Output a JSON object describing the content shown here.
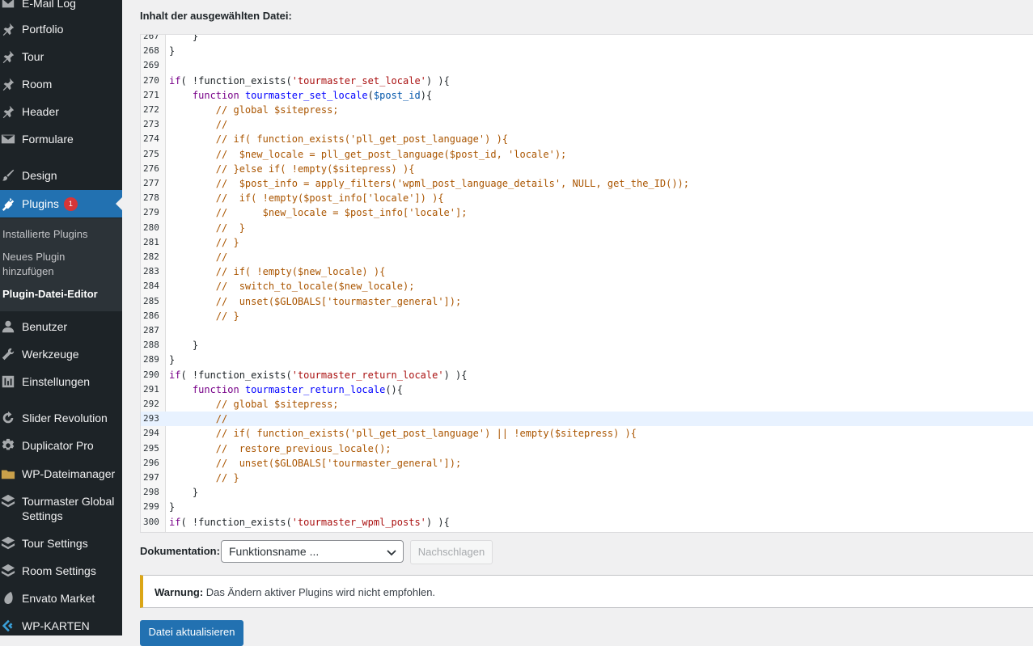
{
  "sidebar": {
    "items": [
      {
        "label": "E-Mail Log",
        "icon": "mail-log-icon"
      },
      {
        "label": "Portfolio",
        "icon": "pin-icon"
      },
      {
        "label": "Tour",
        "icon": "pin-icon"
      },
      {
        "label": "Room",
        "icon": "pin-icon"
      },
      {
        "label": "Header",
        "icon": "pin-icon"
      },
      {
        "label": "Formulare",
        "icon": "mail-icon"
      },
      {
        "label": "Design",
        "icon": "brush-icon"
      },
      {
        "label": "Plugins",
        "icon": "plugin-icon",
        "badge": "1"
      },
      {
        "label": "Benutzer",
        "icon": "user-icon"
      },
      {
        "label": "Werkzeuge",
        "icon": "wrench-icon"
      },
      {
        "label": "Einstellungen",
        "icon": "settings-icon"
      },
      {
        "label": "Slider Revolution",
        "icon": "refresh-icon"
      },
      {
        "label": "Duplicator Pro",
        "icon": "gear-icon"
      },
      {
        "label": "WP-Dateimanager",
        "icon": "folder-icon"
      },
      {
        "label": "Tourmaster Global Settings",
        "icon": "layers-icon"
      },
      {
        "label": "Tour Settings",
        "icon": "layers-icon"
      },
      {
        "label": "Room Settings",
        "icon": "layers-icon"
      },
      {
        "label": "Envato Market",
        "icon": "envato-icon"
      },
      {
        "label": "WP-KARTEN",
        "icon": "map-icon"
      }
    ],
    "submenu": [
      {
        "label": "Installierte Plugins"
      },
      {
        "label": "Neues Plugin hinzufügen"
      },
      {
        "label": "Plugin-Datei-Editor"
      }
    ]
  },
  "main": {
    "file_heading": "Inhalt der ausgewählten Datei:",
    "code_lines": [
      {
        "n": "267",
        "code": "    }"
      },
      {
        "n": "268",
        "code": "}"
      },
      {
        "n": "269",
        "code": ""
      },
      {
        "n": "270",
        "code": "if( !function_exists('tourmaster_set_locale') ){"
      },
      {
        "n": "271",
        "code": "    function tourmaster_set_locale($post_id){"
      },
      {
        "n": "272",
        "code": "        // global $sitepress;"
      },
      {
        "n": "273",
        "code": "        //"
      },
      {
        "n": "274",
        "code": "        // if( function_exists('pll_get_post_language') ){"
      },
      {
        "n": "275",
        "code": "        //  $new_locale = pll_get_post_language($post_id, 'locale');"
      },
      {
        "n": "276",
        "code": "        // }else if( !empty($sitepress) ){"
      },
      {
        "n": "277",
        "code": "        //  $post_info = apply_filters('wpml_post_language_details', NULL, get_the_ID());"
      },
      {
        "n": "278",
        "code": "        //  if( !empty($post_info['locale']) ){"
      },
      {
        "n": "279",
        "code": "        //      $new_locale = $post_info['locale'];"
      },
      {
        "n": "280",
        "code": "        //  }"
      },
      {
        "n": "281",
        "code": "        // }"
      },
      {
        "n": "282",
        "code": "        //"
      },
      {
        "n": "283",
        "code": "        // if( !empty($new_locale) ){"
      },
      {
        "n": "284",
        "code": "        //  switch_to_locale($new_locale);"
      },
      {
        "n": "285",
        "code": "        //  unset($GLOBALS['tourmaster_general']);"
      },
      {
        "n": "286",
        "code": "        // }"
      },
      {
        "n": "287",
        "code": ""
      },
      {
        "n": "288",
        "code": "    }"
      },
      {
        "n": "289",
        "code": "}"
      },
      {
        "n": "290",
        "code": "if( !function_exists('tourmaster_return_locale') ){"
      },
      {
        "n": "291",
        "code": "    function tourmaster_return_locale(){"
      },
      {
        "n": "292",
        "code": "        // global $sitepress;"
      },
      {
        "n": "293",
        "code": "        //"
      },
      {
        "n": "294",
        "code": "        // if( function_exists('pll_get_post_language') || !empty($sitepress) ){"
      },
      {
        "n": "295",
        "code": "        //  restore_previous_locale();"
      },
      {
        "n": "296",
        "code": "        //  unset($GLOBALS['tourmaster_general']);"
      },
      {
        "n": "297",
        "code": "        // }"
      },
      {
        "n": "298",
        "code": "    }"
      },
      {
        "n": "299",
        "code": "}"
      },
      {
        "n": "300",
        "code": "if( !function_exists('tourmaster_wpml_posts') ){"
      }
    ],
    "highlighted_line": "293",
    "doc_label": "Dokumentation:",
    "doc_select_value": "Funktionsname ...",
    "lookup_label": "Nachschlagen",
    "notice_strong": "Warnung:",
    "notice_text": " Das Ändern aktiver Plugins wird nicht empfohlen.",
    "update_label": "Datei aktualisieren"
  },
  "colors": {
    "sidebar_bg": "#1d2327",
    "active_bg": "#2271b1",
    "keyword": "#770088",
    "string": "#aa1111",
    "comment": "#aa5500",
    "variable": "#0055aa",
    "def": "#0000ff",
    "warning_border": "#dba617"
  }
}
